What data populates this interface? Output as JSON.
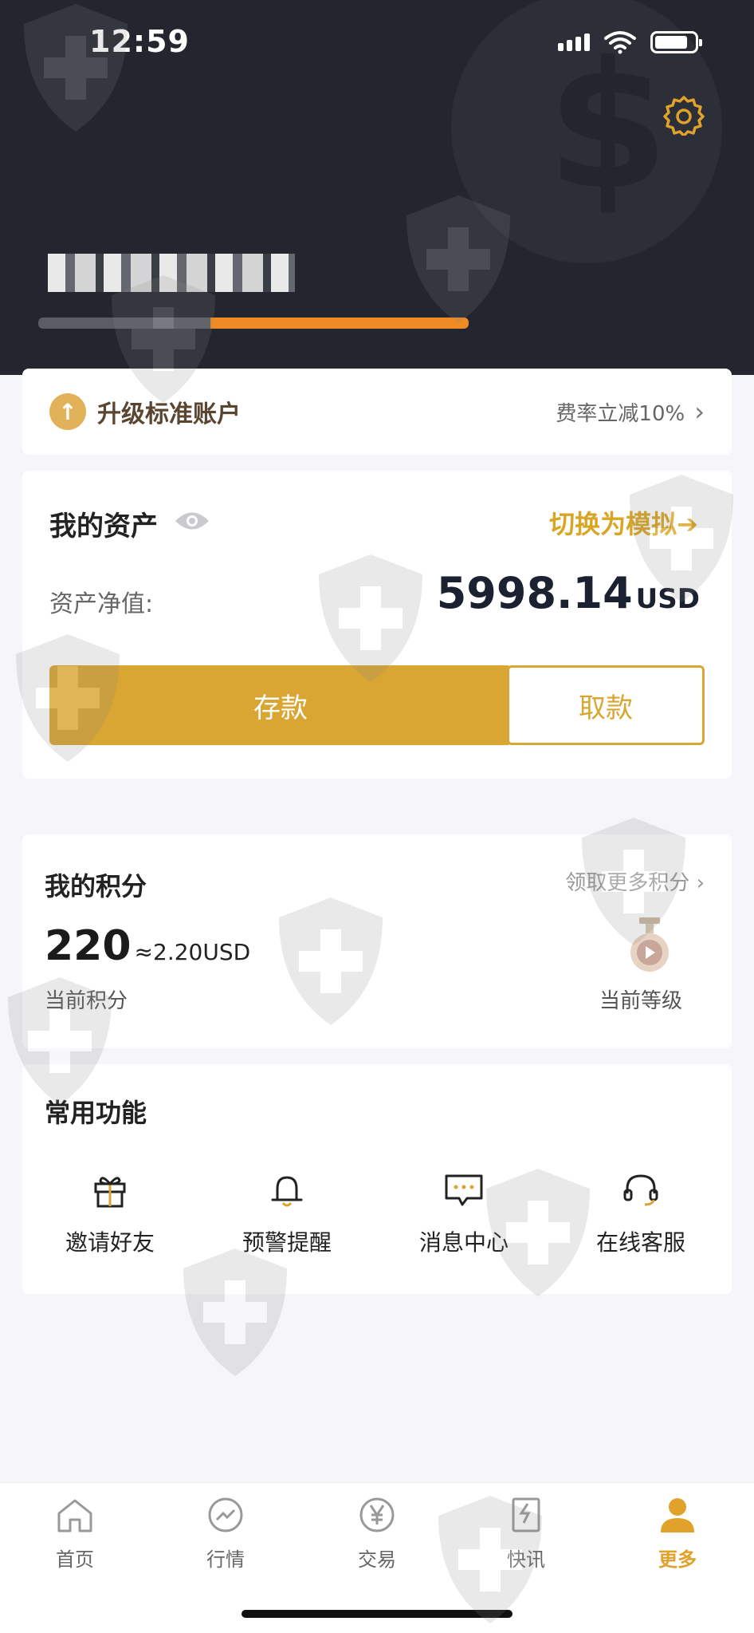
{
  "status_bar": {
    "time": "12:59"
  },
  "upgrade": {
    "title": "升级标准账户",
    "offer": "费率立减10%"
  },
  "assets": {
    "title": "我的资产",
    "switch_label": "切换为模拟➔",
    "net_value_label": "资产净值:",
    "net_value": "5998.14",
    "currency": "USD",
    "deposit_label": "存款",
    "withdraw_label": "取款"
  },
  "points": {
    "title": "我的积分",
    "more_label": "领取更多积分",
    "value": "220",
    "approx": "≈2.20USD",
    "current_points_label": "当前积分",
    "current_level_label": "当前等级"
  },
  "functions": {
    "title": "常用功能",
    "items": [
      {
        "label": "邀请好友",
        "icon": "gift-icon"
      },
      {
        "label": "预警提醒",
        "icon": "bell-icon"
      },
      {
        "label": "消息中心",
        "icon": "message-icon"
      },
      {
        "label": "在线客服",
        "icon": "headset-icon"
      }
    ]
  },
  "tabbar": {
    "items": [
      {
        "label": "首页",
        "icon": "home-icon"
      },
      {
        "label": "行情",
        "icon": "market-icon"
      },
      {
        "label": "交易",
        "icon": "yen-icon"
      },
      {
        "label": "快讯",
        "icon": "news-icon"
      },
      {
        "label": "更多",
        "icon": "person-icon",
        "active": true
      }
    ]
  },
  "colors": {
    "accent": "#d9a533",
    "header_bg": "#23262e",
    "page_bg": "#f6f6fa"
  }
}
